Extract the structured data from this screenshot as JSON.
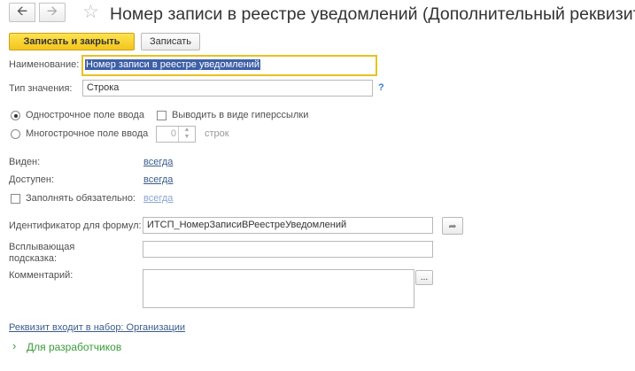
{
  "nav": {
    "back_icon": "arrow-left-icon",
    "forward_icon": "arrow-right-icon",
    "star_icon": "star-icon"
  },
  "window": {
    "title": "Номер записи в реестре уведомлений (Дополнительный реквизит)"
  },
  "toolbar": {
    "save_close_label": "Записать и закрыть",
    "save_label": "Записать"
  },
  "form": {
    "name_label": "Наименование:",
    "name_value": "Номер записи в реестре уведомлений",
    "type_label": "Тип значения:",
    "type_value": "Строка",
    "type_help": "?",
    "single_line_label": "Однострочное поле ввода",
    "multi_line_label": "Многострочное поле ввода",
    "hyperlink_label": "Выводить в виде гиперссылки",
    "lines_value": "0",
    "lines_suffix": "строк",
    "visible_label": "Виден:",
    "visible_value": "всегда",
    "available_label": "Доступен:",
    "available_value": "всегда",
    "required_label": "Заполнять обязательно:",
    "required_value": "всегда",
    "formula_id_label": "Идентификатор для формул:",
    "formula_id_value": "ИТСП_НомерЗаписиВРеестреУведомлений",
    "tooltip_label_1": "Всплывающая",
    "tooltip_label_2": "подсказка:",
    "tooltip_value": "",
    "comment_label": "Комментарий:",
    "comment_value": "",
    "comment_button": "...",
    "set_link": "Реквизит входит в набор: Организации",
    "developers_label": "Для разработчиков"
  },
  "colors": {
    "accent_yellow": "#f4c51c",
    "focus_border": "#e8c11e",
    "link": "#3b5c8c",
    "green": "#3a9a3a"
  }
}
